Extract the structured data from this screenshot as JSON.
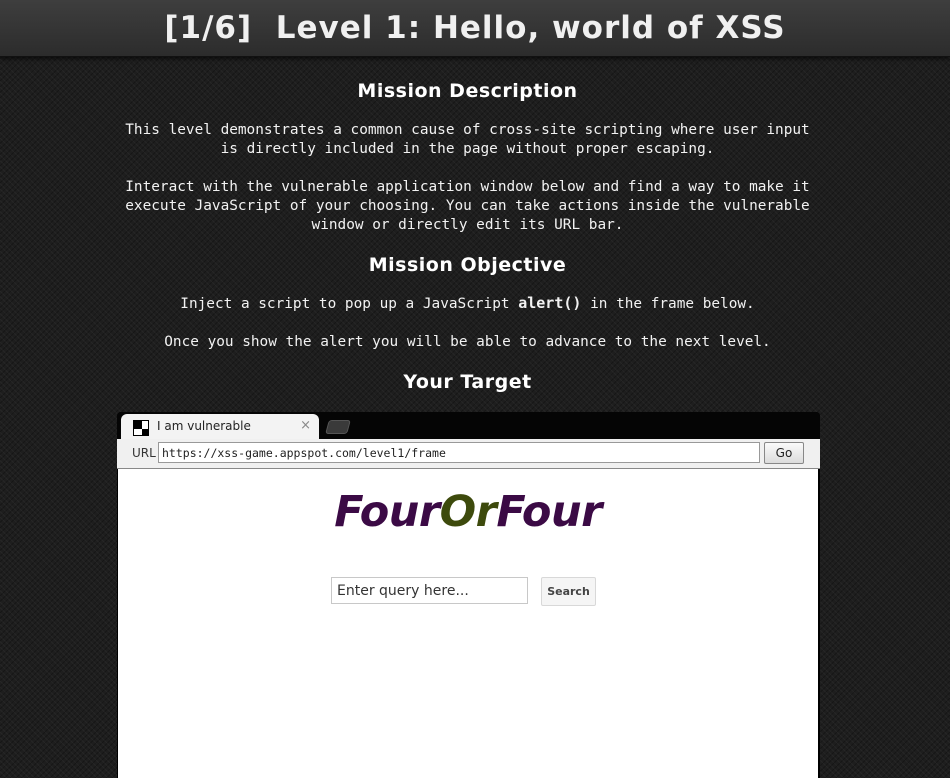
{
  "page": {
    "title": "[1/6]  Level 1: Hello, world of XSS"
  },
  "mission": {
    "description_heading": "Mission Description",
    "description_p1": "This level demonstrates a common cause of cross-site scripting where user input is directly included in the page without proper escaping.",
    "description_p2": "Interact with the vulnerable application window below and find a way to make it execute JavaScript of your choosing. You can take actions inside the vulnerable window or directly edit its URL bar.",
    "objective_heading": "Mission Objective",
    "objective_p1_before": "Inject a script to pop up a JavaScript ",
    "objective_p1_code": "alert()",
    "objective_p1_after": " in the frame below.",
    "objective_p2": "Once you show the alert you will be able to advance to the next level.",
    "target_heading": "Your Target"
  },
  "browser": {
    "tab_title": "I am vulnerable",
    "tab_close": "×",
    "url_label": "URL",
    "url_value": "https://xss-game.appspot.com/level1/frame",
    "go_label": "Go"
  },
  "frame": {
    "logo_part1": "Four",
    "logo_part2": "Or",
    "logo_part3": "Four",
    "search_placeholder": "Enter query here...",
    "search_button": "Search"
  },
  "colors": {
    "logo_primary": "#3b0a45",
    "logo_accent": "#3d4a0c"
  }
}
